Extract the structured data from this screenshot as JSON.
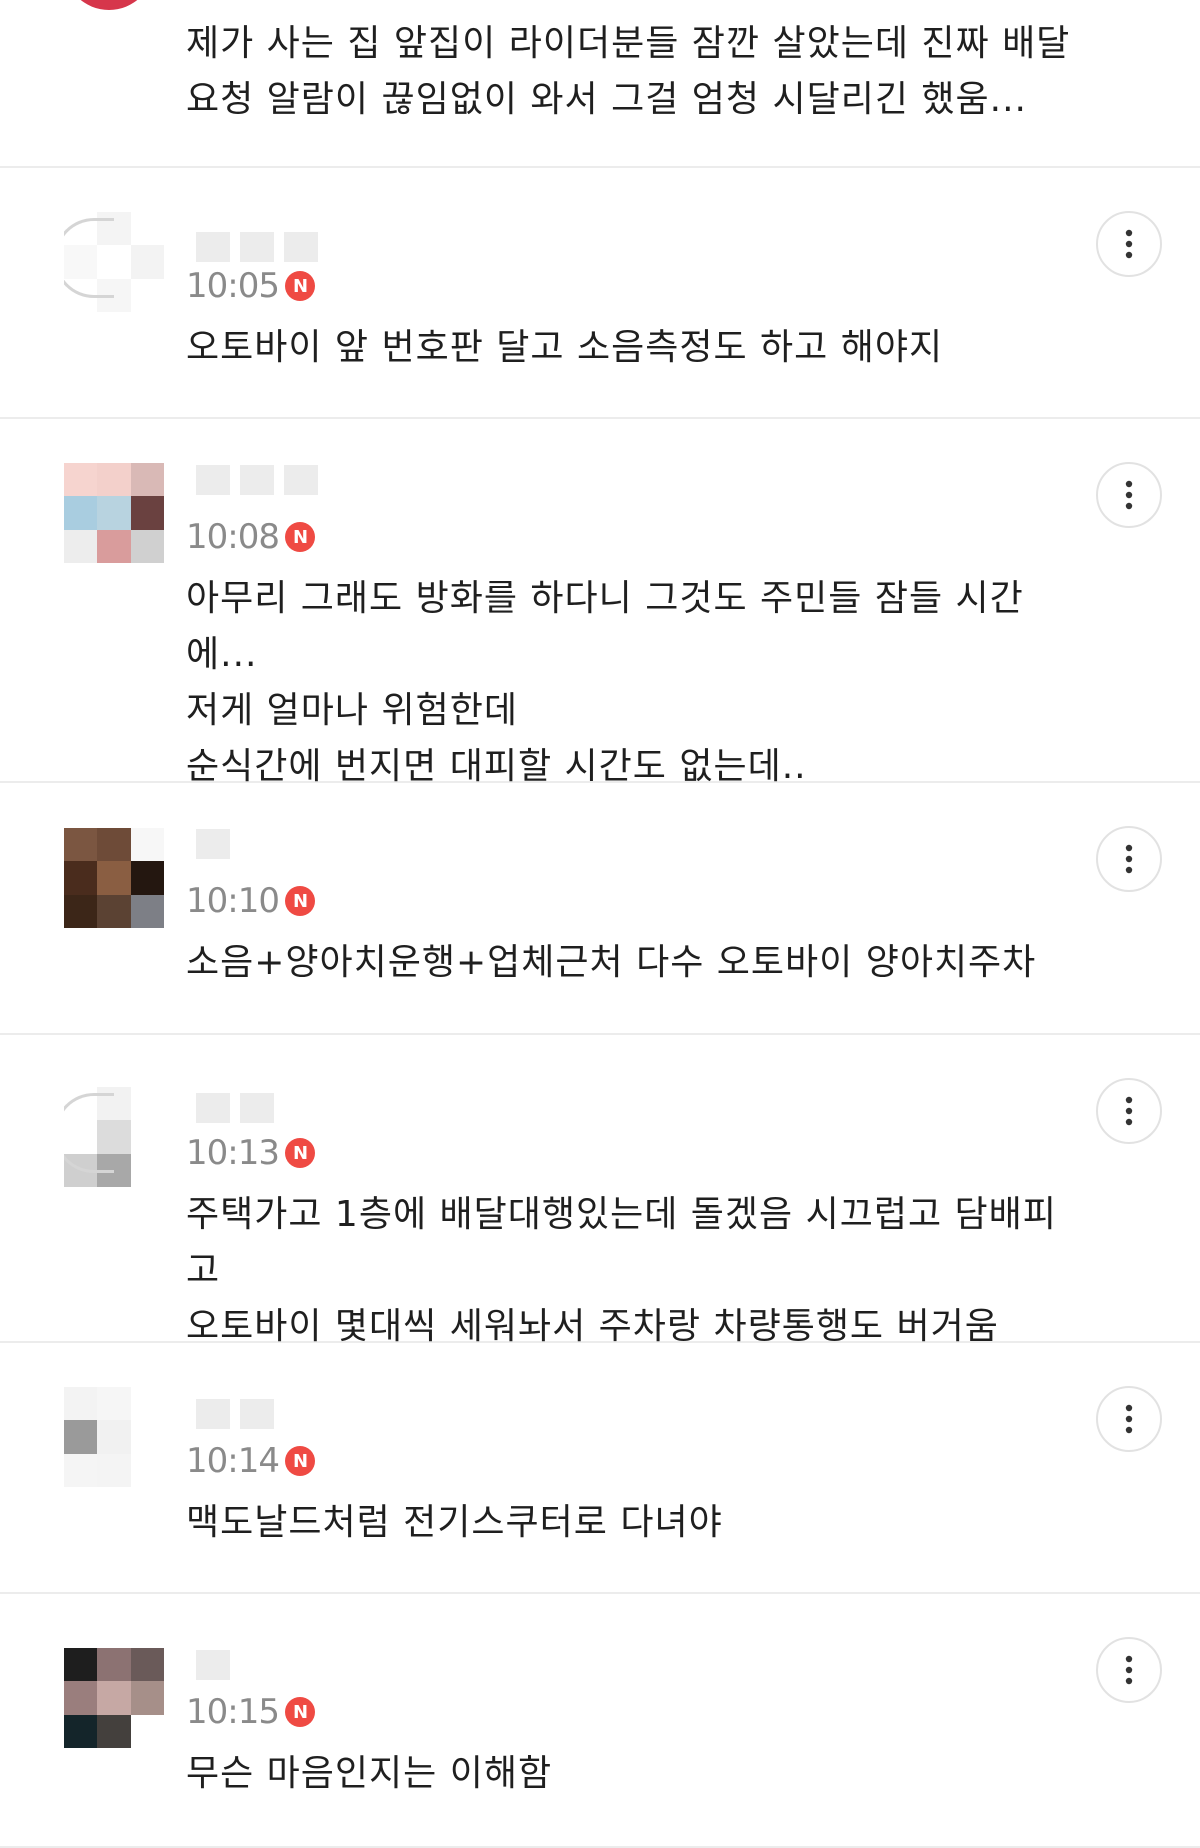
{
  "comments": [
    {
      "text": "제가 사는 집 앞집이 라이더분들 잠깐 살았는데 진짜 배달\n요청 알람이 끊임없이 와서 그걸 엄청 시달리긴 했움...",
      "partial": true
    },
    {
      "time": "10:05",
      "badge": "N",
      "text": "오토바이 앞 번호판 달고 소음측정도 하고 해야지",
      "avatar": [
        "#ffffff",
        "#f4f4f4",
        "#ffffff",
        "#f8f8f8",
        "#ffffff",
        "#f3f3f3",
        "#ffffff",
        "#f6f6f6",
        "#ffffff"
      ]
    },
    {
      "time": "10:08",
      "badge": "N",
      "text": "아무리 그래도 방화를 하다니 그것도 주민들 잠들 시간에...\n저게 얼마나 위험한데\n순식간에 번지면 대피할 시간도 없는데..",
      "avatar": [
        "#f6d4cf",
        "#f3d0cb",
        "#d9b9b6",
        "#a9cde0",
        "#b8d3e0",
        "#6a4140",
        "#ededed",
        "#d99c9c",
        "#d0d0d0"
      ]
    },
    {
      "time": "10:10",
      "badge": "N",
      "text": "소음+양아치운행+업체근처 다수 오토바이 양아치주차",
      "avatar": [
        "#7b5641",
        "#6e4b38",
        "#f7f7f7",
        "#4a2c1d",
        "#8a5e42",
        "#241710",
        "#3c2618",
        "#5b4233",
        "#7d7f86"
      ]
    },
    {
      "time": "10:13",
      "badge": "N",
      "text": "주택가고 1층에 배달대행있는데 돌겠음 시끄럽고 담배피고\n오토바이 몇대씩 세워놔서 주차랑 차량통행도 버거움",
      "avatar": [
        "#ffffff",
        "#f2f2f2",
        "#ffffff",
        "#ffffff",
        "#dcdcdc",
        "#ffffff",
        "#cfcfcf",
        "#a8a8a8",
        "#ffffff"
      ]
    },
    {
      "time": "10:14",
      "badge": "N",
      "text": "맥도날드처럼 전기스쿠터로 다녀야",
      "avatar": [
        "#f3f3f3",
        "#f6f6f6",
        "#ffffff",
        "#9a9a9a",
        "#f1f1f1",
        "#ffffff",
        "#f5f5f5",
        "#f4f4f4",
        "#ffffff"
      ]
    },
    {
      "time": "10:15",
      "badge": "N",
      "text": "무슨 마음인지는 이해함",
      "avatar": [
        "#1e1e1e",
        "#8c7272",
        "#6a5a59",
        "#9a7e7d",
        "#c6a8a4",
        "#a68f89",
        "#14252a",
        "#44403d",
        "#ffffff"
      ]
    }
  ],
  "icons": {
    "more": "more-vertical-icon",
    "badge": "n-badge-icon"
  },
  "colors": {
    "badge": "#ef4a43",
    "time": "#8a8a8a",
    "divider": "#ececec"
  }
}
